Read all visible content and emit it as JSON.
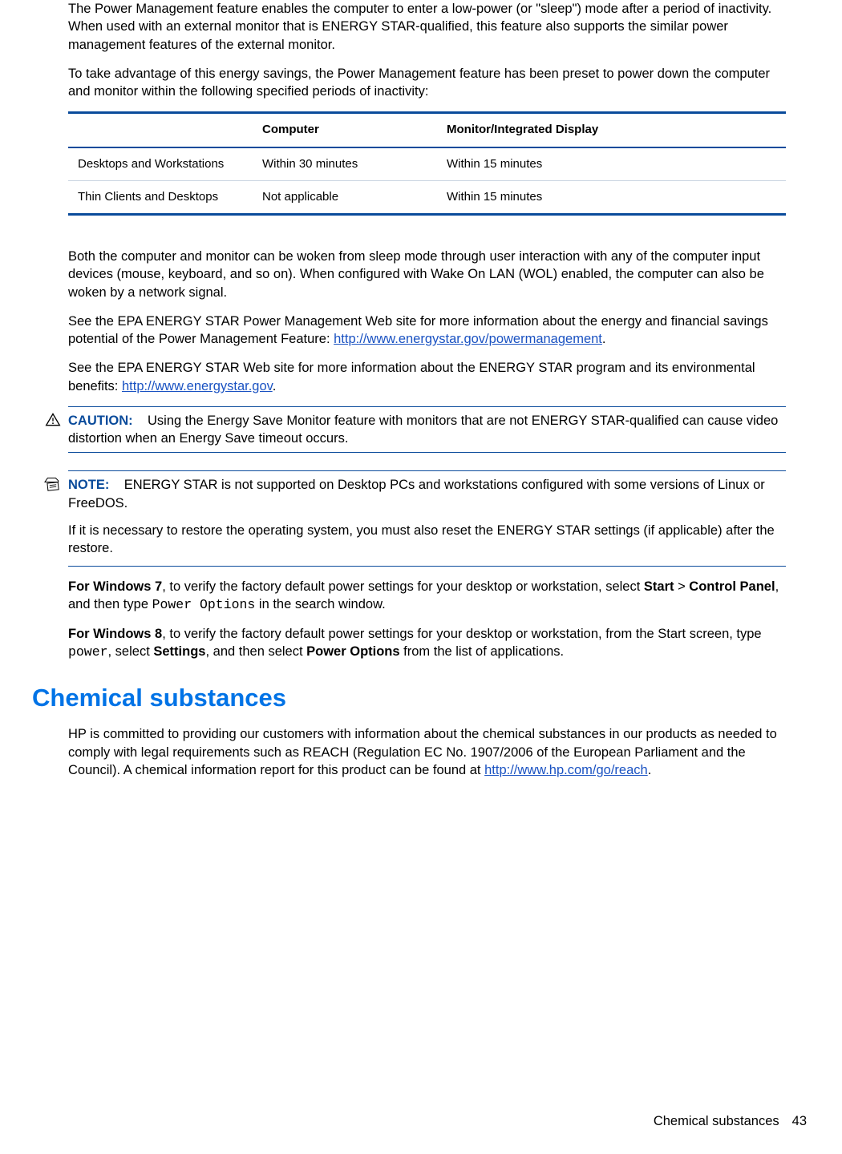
{
  "intro": {
    "p1": "The Power Management feature enables the computer to enter a low-power (or \"sleep\") mode after a period of inactivity. When used with an external monitor that is ENERGY STAR-qualified, this feature also supports the similar power management features of the external monitor.",
    "p2": "To take advantage of this energy savings, the Power Management feature has been preset to power down the computer and monitor within the following specified periods of inactivity:"
  },
  "table": {
    "headers": [
      "",
      "Computer",
      "Monitor/Integrated Display"
    ],
    "rows": [
      [
        "Desktops and Workstations",
        "Within 30 minutes",
        "Within 15 minutes"
      ],
      [
        "Thin Clients and Desktops",
        "Not applicable",
        "Within 15 minutes"
      ]
    ]
  },
  "after_table": {
    "p3": "Both the computer and monitor can be woken from sleep mode through user interaction with any of the computer input devices (mouse, keyboard, and so on). When configured with Wake On LAN (WOL) enabled, the computer can also be woken by a network signal.",
    "p4a": "See the EPA ENERGY STAR Power Management Web site for more information about the energy and financial savings potential of the Power Management Feature: ",
    "p4link": "http://www.energystar.gov/powermanagement",
    "p4b": ".",
    "p5a": "See the EPA ENERGY STAR Web site for more information about the ENERGY STAR program and its environmental benefits: ",
    "p5link": "http://www.energystar.gov",
    "p5b": "."
  },
  "caution": {
    "label": "CAUTION:",
    "text": "Using the Energy Save Monitor feature with monitors that are not ENERGY STAR-qualified can cause video distortion when an Energy Save timeout occurs."
  },
  "note": {
    "label": "NOTE:",
    "p1": "ENERGY STAR is not supported on Desktop PCs and workstations configured with some versions of Linux or FreeDOS.",
    "p2": "If it is necessary to restore the operating system, you must also reset the ENERGY STAR settings (if applicable) after the restore."
  },
  "win7": {
    "b1": "For Windows 7",
    "t1": ", to verify the factory default power settings for your desktop or workstation, select ",
    "b2": "Start",
    "t2": " > ",
    "b3": "Control Panel",
    "t3": ", and then type ",
    "code": "Power Options",
    "t4": " in the search window."
  },
  "win8": {
    "b1": "For Windows 8",
    "t1": ", to verify the factory default power settings for your desktop or workstation, from the Start screen, type ",
    "code": "power",
    "t2": ", select ",
    "b2": "Settings",
    "t3": ", and then select ",
    "b3": "Power Options",
    "t4": " from the list of applications."
  },
  "chem": {
    "heading": "Chemical substances",
    "p_a": "HP is committed to providing our customers with information about the chemical substances in our products as needed to comply with legal requirements such as REACH (Regulation EC No. 1907/2006 of the European Parliament and the Council). A chemical information report for this product can be found at ",
    "link": "http://www.hp.com/go/reach",
    "p_b": "."
  },
  "footer": {
    "title": "Chemical substances",
    "page": "43"
  }
}
